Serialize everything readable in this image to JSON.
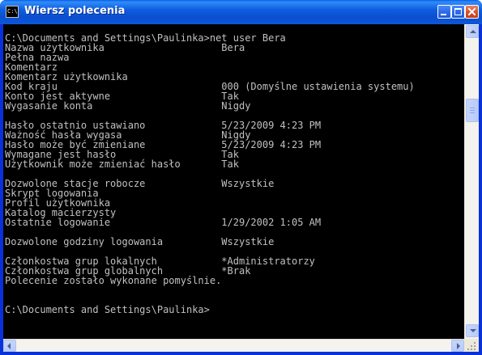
{
  "window": {
    "title": "Wiersz polecenia",
    "icon_label": "C:\\"
  },
  "console": {
    "lines": [
      "C:\\Documents and Settings\\Paulinka>net user Bera",
      "Nazwa użytkownika                    Bera",
      "Pełna nazwa",
      "Komentarz",
      "Komentarz użytkownika",
      "Kod kraju                            000 (Domyślne ustawienia systemu)",
      "Konto jest aktywne                   Tak",
      "Wygasanie konta                      Nigdy",
      "",
      "Hasło ostatnio ustawiano             5/23/2009 4:23 PM",
      "Ważność hasła wygasa                 Nigdy",
      "Hasło może być zmieniane             5/23/2009 4:23 PM",
      "Wymagane jest hasło                  Tak",
      "Użytkownik może zmieniać hasło       Tak",
      "",
      "Dozwolone stacje robocze             Wszystkie",
      "Skrypt logowania",
      "Profil użytkownika",
      "Katalog macierzysty",
      "Ostatnie logowanie                   1/29/2002 1:05 AM",
      "",
      "Dozwolone godziny logowania          Wszystkie",
      "",
      "Członkostwa grup lokalnych           *Administratorzy",
      "Członkostwa grup globalnych          *Brak",
      "Polecenie zostało wykonane pomyślnie.",
      "",
      "",
      "C:\\Documents and Settings\\Paulinka>"
    ]
  },
  "icons": {
    "app": "console-icon",
    "minimize": "minimize-icon",
    "maximize": "maximize-icon",
    "close": "close-icon"
  },
  "colors": {
    "console_bg": "#000000",
    "console_fg": "#c0c0c0",
    "titlebar": "#0a5de8",
    "close_button": "#d8542e"
  }
}
